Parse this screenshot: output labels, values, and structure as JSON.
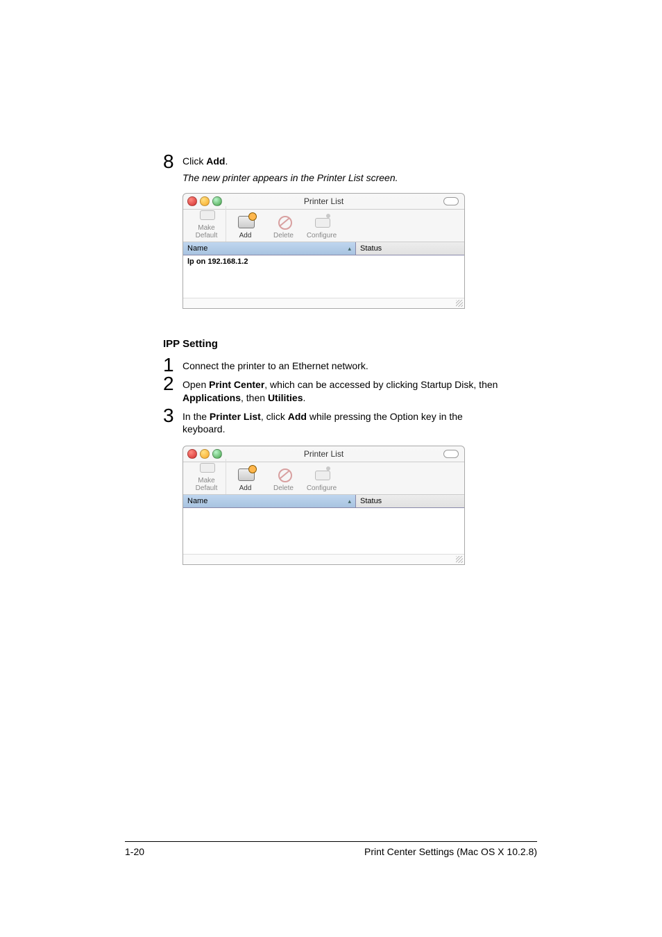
{
  "step8": {
    "text_prefix": "Click ",
    "bold": "Add",
    "suffix": ".",
    "caption": "The new printer appears in the Printer List screen."
  },
  "window": {
    "title": "Printer List",
    "toolbar": {
      "make_default": "Make Default",
      "add": "Add",
      "delete": "Delete",
      "configure": "Configure"
    },
    "columns": {
      "name": "Name",
      "status": "Status"
    },
    "row1": "lp on 192.168.1.2"
  },
  "section_title": "IPP Setting",
  "step1": {
    "text": "Connect the printer to an Ethernet network."
  },
  "step2": {
    "prefix": "Open ",
    "b1": "Print Center",
    "mid1": ", which can be accessed by clicking Startup Disk, then ",
    "b2": "Applications",
    "mid2": ", then ",
    "b3": "Utilities",
    "suffix": "."
  },
  "step3": {
    "prefix": "In the ",
    "b1": "Printer List",
    "mid1": ", click ",
    "b2": "Add",
    "suffix": " while pressing the Option key in the keyboard."
  },
  "footer": {
    "left": "1-20",
    "right": "Print Center Settings (Mac OS X 10.2.8)"
  }
}
